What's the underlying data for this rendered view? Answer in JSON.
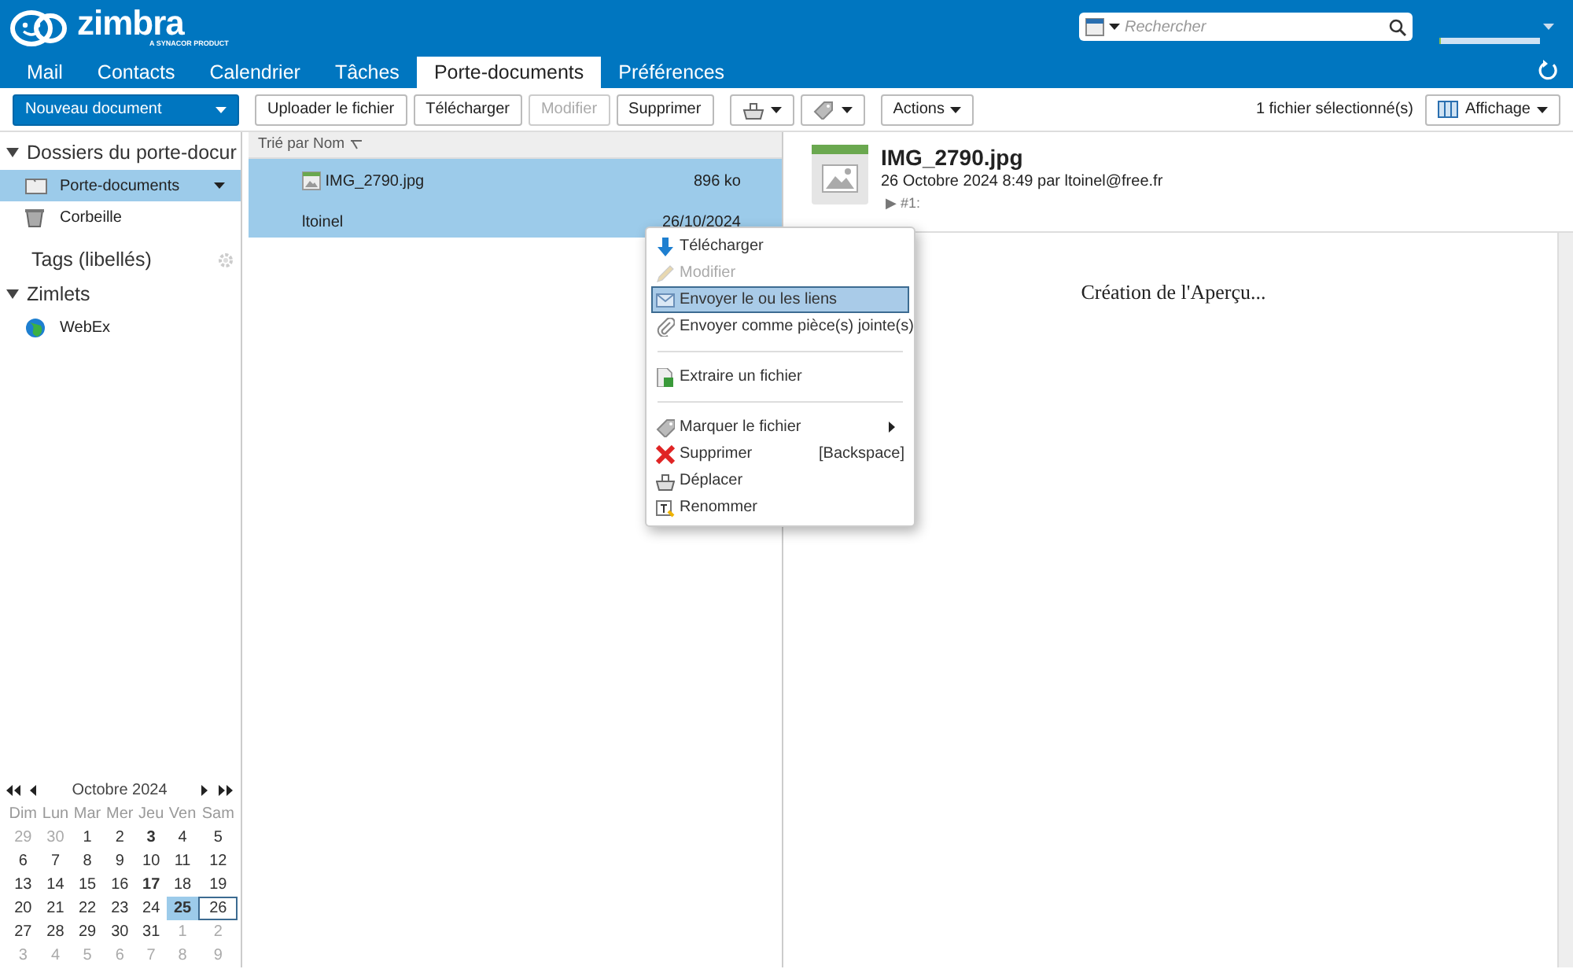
{
  "logo": {
    "name": "zimbra",
    "tagline": "A SYNACOR PRODUCT"
  },
  "search": {
    "placeholder": "Rechercher"
  },
  "tabs": [
    {
      "label": "Mail",
      "selected": false
    },
    {
      "label": "Contacts",
      "selected": false
    },
    {
      "label": "Calendrier",
      "selected": false
    },
    {
      "label": "Tâches",
      "selected": false
    },
    {
      "label": "Porte-documents",
      "selected": true
    },
    {
      "label": "Préférences",
      "selected": false
    }
  ],
  "toolbar": {
    "new_button": "Nouveau document",
    "buttons": [
      {
        "label": "Uploader le fichier",
        "disabled": false
      },
      {
        "label": "Télécharger",
        "disabled": false
      },
      {
        "label": "Modifier",
        "disabled": true
      },
      {
        "label": "Supprimer",
        "disabled": false
      }
    ],
    "actions": "Actions",
    "status": "1 fichier sélectionné(s)",
    "view": "Affichage"
  },
  "sidebar": {
    "sections": [
      {
        "title": "Dossiers du porte-docur",
        "expanded": true,
        "items": [
          {
            "label": "Porte-documents",
            "selected": true
          },
          {
            "label": "Corbeille",
            "selected": false
          }
        ]
      },
      {
        "title": "Tags (libellés)"
      },
      {
        "title": "Zimlets",
        "expanded": true,
        "items": [
          {
            "label": "WebEx",
            "selected": false
          }
        ]
      }
    ]
  },
  "calendar": {
    "month": "Octobre 2024",
    "weekdays": [
      "Dim",
      "Lun",
      "Mar",
      "Mer",
      "Jeu",
      "Ven",
      "Sam"
    ],
    "weeks": [
      [
        {
          "day": "29",
          "outside": true,
          "bold": false,
          "selected": false,
          "today": false
        },
        {
          "day": "30",
          "outside": true,
          "bold": false,
          "selected": false,
          "today": false
        },
        {
          "day": "1",
          "outside": false,
          "bold": false,
          "selected": false,
          "today": false
        },
        {
          "day": "2",
          "outside": false,
          "bold": false,
          "selected": false,
          "today": false
        },
        {
          "day": "3",
          "outside": false,
          "bold": true,
          "selected": false,
          "today": false
        },
        {
          "day": "4",
          "outside": false,
          "bold": false,
          "selected": false,
          "today": false
        },
        {
          "day": "5",
          "outside": false,
          "bold": false,
          "selected": false,
          "today": false
        }
      ],
      [
        {
          "day": "6",
          "outside": false,
          "bold": false,
          "selected": false,
          "today": false
        },
        {
          "day": "7",
          "outside": false,
          "bold": false,
          "selected": false,
          "today": false
        },
        {
          "day": "8",
          "outside": false,
          "bold": false,
          "selected": false,
          "today": false
        },
        {
          "day": "9",
          "outside": false,
          "bold": false,
          "selected": false,
          "today": false
        },
        {
          "day": "10",
          "outside": false,
          "bold": false,
          "selected": false,
          "today": false
        },
        {
          "day": "11",
          "outside": false,
          "bold": false,
          "selected": false,
          "today": false
        },
        {
          "day": "12",
          "outside": false,
          "bold": false,
          "selected": false,
          "today": false
        }
      ],
      [
        {
          "day": "13",
          "outside": false,
          "bold": false,
          "selected": false,
          "today": false
        },
        {
          "day": "14",
          "outside": false,
          "bold": false,
          "selected": false,
          "today": false
        },
        {
          "day": "15",
          "outside": false,
          "bold": false,
          "selected": false,
          "today": false
        },
        {
          "day": "16",
          "outside": false,
          "bold": false,
          "selected": false,
          "today": false
        },
        {
          "day": "17",
          "outside": false,
          "bold": true,
          "selected": false,
          "today": false
        },
        {
          "day": "18",
          "outside": false,
          "bold": false,
          "selected": false,
          "today": false
        },
        {
          "day": "19",
          "outside": false,
          "bold": false,
          "selected": false,
          "today": false
        }
      ],
      [
        {
          "day": "20",
          "outside": false,
          "bold": false,
          "selected": false,
          "today": false
        },
        {
          "day": "21",
          "outside": false,
          "bold": false,
          "selected": false,
          "today": false
        },
        {
          "day": "22",
          "outside": false,
          "bold": false,
          "selected": false,
          "today": false
        },
        {
          "day": "23",
          "outside": false,
          "bold": false,
          "selected": false,
          "today": false
        },
        {
          "day": "24",
          "outside": false,
          "bold": false,
          "selected": false,
          "today": false
        },
        {
          "day": "25",
          "outside": false,
          "bold": true,
          "selected": true,
          "today": false
        },
        {
          "day": "26",
          "outside": false,
          "bold": false,
          "selected": false,
          "today": true
        }
      ],
      [
        {
          "day": "27",
          "outside": false,
          "bold": false,
          "selected": false,
          "today": false
        },
        {
          "day": "28",
          "outside": false,
          "bold": false,
          "selected": false,
          "today": false
        },
        {
          "day": "29",
          "outside": false,
          "bold": false,
          "selected": false,
          "today": false
        },
        {
          "day": "30",
          "outside": false,
          "bold": false,
          "selected": false,
          "today": false
        },
        {
          "day": "31",
          "outside": false,
          "bold": false,
          "selected": false,
          "today": false
        },
        {
          "day": "1",
          "outside": true,
          "bold": false,
          "selected": false,
          "today": false
        },
        {
          "day": "2",
          "outside": true,
          "bold": false,
          "selected": false,
          "today": false
        }
      ],
      [
        {
          "day": "3",
          "outside": true,
          "bold": false,
          "selected": false,
          "today": false
        },
        {
          "day": "4",
          "outside": true,
          "bold": false,
          "selected": false,
          "today": false
        },
        {
          "day": "5",
          "outside": true,
          "bold": false,
          "selected": false,
          "today": false
        },
        {
          "day": "6",
          "outside": true,
          "bold": false,
          "selected": false,
          "today": false
        },
        {
          "day": "7",
          "outside": true,
          "bold": false,
          "selected": false,
          "today": false
        },
        {
          "day": "8",
          "outside": true,
          "bold": false,
          "selected": false,
          "today": false
        },
        {
          "day": "9",
          "outside": true,
          "bold": false,
          "selected": false,
          "today": false
        }
      ]
    ]
  },
  "file_list": {
    "sort_label": "Trié par Nom",
    "files": [
      {
        "name": "IMG_2790.jpg",
        "size": "896 ko",
        "owner": "ltoinel",
        "date": "26/10/2024",
        "selected": true
      }
    ]
  },
  "preview": {
    "title": "IMG_2790.jpg",
    "meta": "26 Octobre 2024 8:49 par ltoinel@free.fr",
    "version": "▶ #1:",
    "body": "Création de l'Aperçu..."
  },
  "context_menu": [
    {
      "kind": "item",
      "label": "Télécharger",
      "disabled": false,
      "selected": false
    },
    {
      "kind": "item",
      "label": "Modifier",
      "disabled": true,
      "selected": false
    },
    {
      "kind": "item",
      "label": "Envoyer le ou les liens",
      "disabled": false,
      "selected": true
    },
    {
      "kind": "item",
      "label": "Envoyer comme pièce(s) jointe(s)",
      "disabled": false,
      "selected": false
    },
    {
      "kind": "separator"
    },
    {
      "kind": "item",
      "label": "Extraire un fichier",
      "disabled": false,
      "selected": false
    },
    {
      "kind": "separator"
    },
    {
      "kind": "submenu",
      "label": "Marquer le fichier",
      "disabled": false,
      "selected": false
    },
    {
      "kind": "item",
      "label": "Supprimer",
      "shortcut": "[Backspace]",
      "disabled": false,
      "selected": false
    },
    {
      "kind": "item",
      "label": "Déplacer",
      "disabled": false,
      "selected": false
    },
    {
      "kind": "item",
      "label": "Renommer",
      "disabled": false,
      "selected": false
    }
  ]
}
